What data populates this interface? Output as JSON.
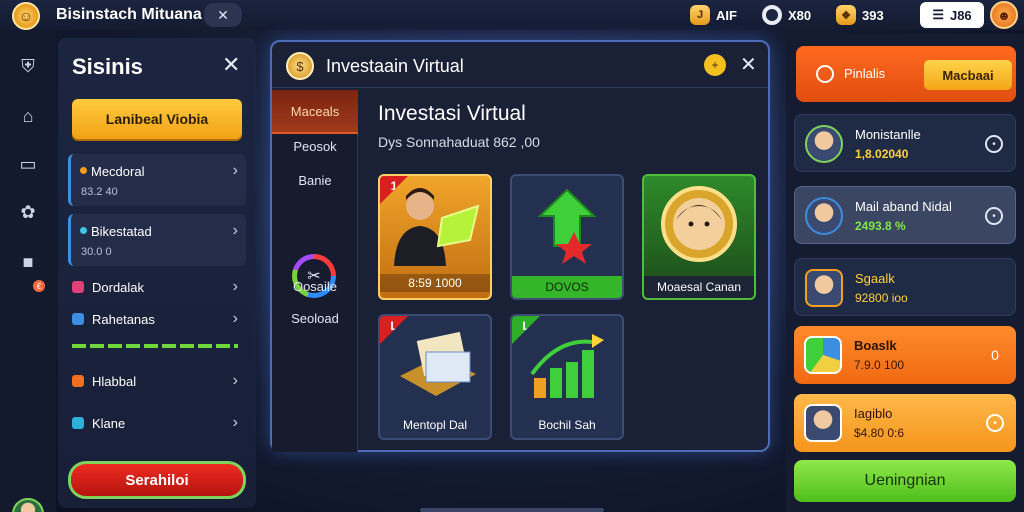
{
  "topbar": {
    "title": "Bisinstach Mituana",
    "close_glyph": "✕",
    "stat1_glyph": "J",
    "stat1_value": "AIF",
    "stat2_value": "X80",
    "stat3_glyph": "❖",
    "stat3_value": "393",
    "menu_label": "J86"
  },
  "left_panel": {
    "title": "Sisinis",
    "primary_button": "Lanibeal Viobia",
    "cards": [
      {
        "name": "Mecdoral",
        "sub": "83.2 40"
      },
      {
        "name": "Bikestatad",
        "sub": "30.0 0"
      }
    ],
    "rows": [
      "Dordalak",
      "Rahetanas",
      "Hlabbal",
      "Klane"
    ],
    "bottom_button": "Serahiloi"
  },
  "main_window": {
    "title": "Investaain Virtual",
    "tabs": [
      "Maceals",
      "Peosok",
      "Banie",
      "Oosaile",
      "Seoload"
    ],
    "content_title": "Investasi Virtual",
    "content_sub": "Dys Sonnahaduat 862 ,00",
    "tiles": [
      {
        "label": "8:59 1000",
        "flag": "1"
      },
      {
        "label": "DOVOS"
      },
      {
        "label": "Moaesal Canan"
      },
      {
        "label": "Mentopl Dal",
        "flag": "L"
      },
      {
        "label": "Bochil Sah",
        "flag": "L"
      }
    ]
  },
  "right_panel": {
    "header_label": "Pinlalis",
    "header_button": "Macbaai",
    "items": [
      {
        "name": "Monistanlle",
        "value": "1,8.02040"
      },
      {
        "name": "Mail aband Nidal",
        "value": "2493.8 %"
      },
      {
        "name": "Sgaalk",
        "value": "92800 ioo"
      },
      {
        "name": "Boaslk",
        "value": "7.9.0 100"
      },
      {
        "name": "Iagiblo",
        "value": "$4.80 0:6"
      }
    ],
    "bottom_button": "Ueningnian"
  },
  "colors": {
    "accent_orange": "#ff6a1f",
    "accent_yellow": "#f4c021",
    "accent_green": "#6fd83b",
    "danger_red": "#e02a20",
    "window_border": "#4c6cb8"
  },
  "icons": [
    "shield-icon",
    "map-icon",
    "book-icon",
    "gear-icon",
    "chat-icon"
  ]
}
